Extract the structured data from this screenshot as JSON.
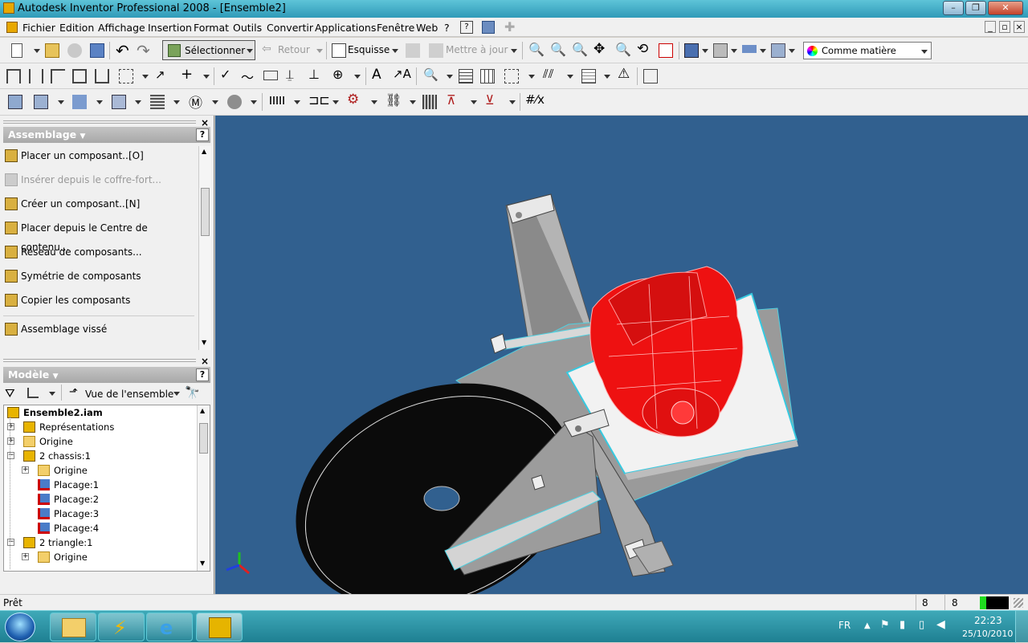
{
  "window": {
    "title": "Autodesk Inventor Professional 2008 - [Ensemble2]",
    "controls": {
      "minimize": "–",
      "restore": "❐",
      "close": "✕"
    }
  },
  "menu": {
    "items": [
      "Fichier",
      "Edition",
      "Affichage",
      "Insertion",
      "Format",
      "Outils",
      "Convertir",
      "Applications",
      "Fenêtre",
      "Web",
      "?"
    ],
    "doc_controls": [
      "_",
      "▫",
      "×"
    ]
  },
  "toolbar1": {
    "select_label": "Sélectionner",
    "back_label": "Retour",
    "sketch_label": "Esquisse",
    "update_label": "Mettre à jour",
    "material_label": "Comme matière"
  },
  "assembly_panel": {
    "title": "Assemblage",
    "help": "?",
    "commands": [
      {
        "label": "Placer un composant...",
        "shortcut": "[O]",
        "icon": "place-component-icon",
        "enabled": true
      },
      {
        "label": "Insérer depuis le coffre-fort...",
        "shortcut": "",
        "icon": "vault-icon",
        "enabled": false
      },
      {
        "label": "Créer un composant...",
        "shortcut": "[N]",
        "icon": "create-component-icon",
        "enabled": true
      },
      {
        "label": "Placer depuis le Centre de contenu...",
        "shortcut": "",
        "icon": "content-center-icon",
        "enabled": true
      },
      {
        "label": "Réseau de composants...",
        "shortcut": "",
        "icon": "pattern-icon",
        "enabled": true
      },
      {
        "label": "Symétrie de composants",
        "shortcut": "",
        "icon": "mirror-icon",
        "enabled": true
      },
      {
        "label": "Copier les composants",
        "shortcut": "",
        "icon": "copy-icon",
        "enabled": true
      },
      {
        "label": "Assemblage vissé",
        "shortcut": "",
        "icon": "bolted-icon",
        "enabled": true
      }
    ]
  },
  "model_panel": {
    "title": "Modèle",
    "help": "?",
    "view_label": "Vue de l'ensemble",
    "tree": [
      {
        "label": "Ensemble2.iam",
        "level": 0,
        "expander": "",
        "icon": "assembly-icon",
        "bold": true
      },
      {
        "label": "Représentations",
        "level": 0,
        "expander": "+",
        "icon": "representations-icon",
        "bold": false
      },
      {
        "label": "Origine",
        "level": 0,
        "expander": "+",
        "icon": "folder-icon",
        "bold": false
      },
      {
        "label": "2 chassis:1",
        "level": 0,
        "expander": "−",
        "icon": "subassembly-icon",
        "bold": false
      },
      {
        "label": "Origine",
        "level": 1,
        "expander": "+",
        "icon": "folder-icon",
        "bold": false
      },
      {
        "label": "Placage:1",
        "level": 1,
        "expander": "",
        "icon": "constraint-icon",
        "bold": false
      },
      {
        "label": "Placage:2",
        "level": 1,
        "expander": "",
        "icon": "constraint-icon",
        "bold": false
      },
      {
        "label": "Placage:3",
        "level": 1,
        "expander": "",
        "icon": "constraint-icon",
        "bold": false
      },
      {
        "label": "Placage:4",
        "level": 1,
        "expander": "",
        "icon": "constraint-icon",
        "bold": false
      },
      {
        "label": "2 triangle:1",
        "level": 0,
        "expander": "−",
        "icon": "part-icon",
        "bold": false
      },
      {
        "label": "Origine",
        "level": 1,
        "expander": "+",
        "icon": "folder-icon",
        "bold": false
      }
    ]
  },
  "status": {
    "text": "Prêt",
    "count1": "8",
    "count2": "8"
  },
  "taskbar": {
    "language": "FR",
    "time": "22:23",
    "date": "25/10/2010"
  }
}
